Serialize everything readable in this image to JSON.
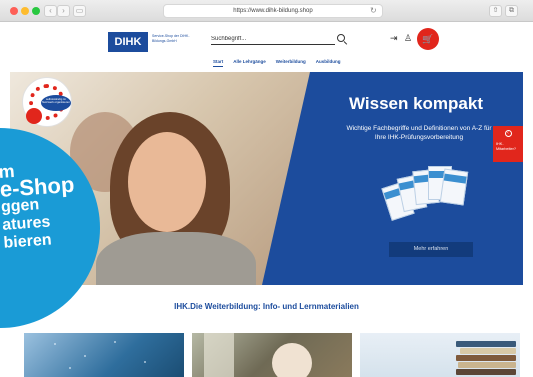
{
  "browser": {
    "url": "https://www.dihk-bildung.shop"
  },
  "header": {
    "logo_text": "DIHK",
    "logo_tagline": "Service-Shop der DIHK-Bildungs-GmbH",
    "search_placeholder": "Suchbegriff...",
    "nav": [
      {
        "label": "Start",
        "active": true
      },
      {
        "label": "Alle Lehrgänge",
        "active": false
      },
      {
        "label": "Weiterbildung",
        "active": false
      },
      {
        "label": "Ausbildung",
        "active": false
      }
    ]
  },
  "hero": {
    "title": "Wissen kompakt",
    "text": "Wichtige Fachbegriffe und Definitionen von A-Z für Ihre IHK-Prüfungsvorbereitung",
    "cta_label": "Mehr erfahren",
    "badge_text": "selbstständig im Netzwerk organisieren"
  },
  "side_tab": {
    "label": "IHK-Mitarbeiter?"
  },
  "promo": {
    "lines": [
      "m",
      "e-Shop",
      "ggen",
      "atures",
      "bieren"
    ]
  },
  "section": {
    "title": "IHK.Die Weiterbildung: Info- und Lernmaterialien"
  },
  "colors": {
    "brand_blue": "#1c4c9d",
    "brand_red": "#e1261c",
    "promo_blue": "#1a9bd6"
  },
  "icons": {
    "search": "search-icon",
    "login": "login-icon",
    "user": "user-icon",
    "cart": "cart-icon"
  }
}
